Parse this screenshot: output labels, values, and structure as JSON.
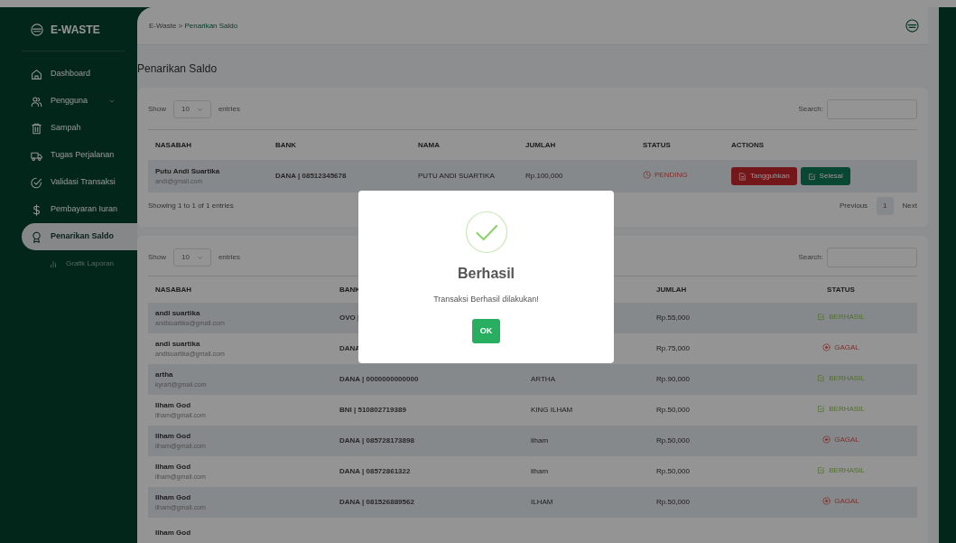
{
  "sidebar": {
    "logo": "E-WASTE",
    "items": [
      {
        "label": "Dashboard",
        "kind": "item",
        "selected": false
      },
      {
        "label": "Pengguna",
        "kind": "dropdown",
        "selected": false,
        "expanded": false
      },
      {
        "label": "Sampah",
        "kind": "item",
        "selected": false
      },
      {
        "label": "Tugas Perjalanan",
        "kind": "item",
        "selected": false
      },
      {
        "label": "Validasi Transaksi",
        "kind": "item",
        "selected": false
      },
      {
        "label": "Pembayaran Iuran",
        "kind": "item",
        "selected": false
      },
      {
        "label": "Penarikan Saldo",
        "kind": "item",
        "selected": true
      },
      {
        "label": "Grafik Laporan",
        "kind": "subitem",
        "selected": false
      }
    ]
  },
  "breadcrumb": {
    "items": [
      "E-Waste",
      "Penarikan Saldo"
    ],
    "separator": ">"
  },
  "page_title": "Penarikan Saldo",
  "pending_table": {
    "show_label": "Show",
    "length": "10",
    "entries_label": "entries",
    "search_label": "Search:",
    "columns": [
      "NASABAH",
      "BANK",
      "NAMA",
      "JUMLAH",
      "STATUS",
      "ACTIONS"
    ],
    "rows": [
      {
        "name": "Putu Andi Suartika",
        "email": "andi@gmail.com",
        "bank": "DANA | 08512345678",
        "nama": "PUTU ANDI SUARTIKA",
        "jumlah": "Rp.100,000",
        "status": {
          "kind": "pending",
          "label": "PENDING"
        },
        "actions": [
          "Tangguhkan",
          "Selesai"
        ]
      }
    ],
    "info": "Showing 1 to 1 of 1 entries",
    "pagination": {
      "previous": "Previous",
      "pages": [
        {
          "label": "1",
          "selected": true
        }
      ],
      "next": "Next"
    }
  },
  "history_table": {
    "show_label": "Show",
    "length": "10",
    "entries_label": "entries",
    "search_label": "Search:",
    "columns": [
      "NASABAH",
      "BANK",
      "JUMLAH",
      "STATUS"
    ],
    "rows": [
      {
        "name": "andi suartika",
        "email": "andisuartika@gmail.com",
        "bank": "OVO |",
        "jumlah": "Rp.55,000",
        "status": {
          "kind": "berhasil",
          "label": "BERHASIL"
        }
      },
      {
        "name": "andi suartika",
        "email": "andisuartika@gmail.com",
        "bank": "DANA",
        "jumlah": "Rp.75,000",
        "status": {
          "kind": "gagal",
          "label": "GAGAL"
        }
      },
      {
        "name": "artha",
        "email": "kyrart@gmail.com",
        "bank": "DANA | 0000000000000",
        "nama": "ARTHA",
        "jumlah": "Rp.90,000",
        "status": {
          "kind": "berhasil",
          "label": "BERHASIL"
        }
      },
      {
        "name": "Ilham God",
        "email": "ilham@gmail.com",
        "bank": "BNI | 510802719389",
        "nama": "KING ILHAM",
        "jumlah": "Rp.50,000",
        "status": {
          "kind": "berhasil",
          "label": "BERHASIL"
        }
      },
      {
        "name": "Ilham God",
        "email": "ilham@gmail.com",
        "bank": "DANA | 085728173898",
        "nama": "ilham",
        "jumlah": "Rp.50,000",
        "status": {
          "kind": "gagal",
          "label": "GAGAL"
        }
      },
      {
        "name": "Ilham God",
        "email": "ilham@gmail.com",
        "bank": "DANA | 08572861322",
        "nama": "ilham",
        "jumlah": "Rp.50,000",
        "status": {
          "kind": "berhasil",
          "label": "BERHASIL"
        }
      },
      {
        "name": "Ilham God",
        "email": "ilham@gmail.com",
        "bank": "DANA | 081526889562",
        "nama": "ILHAM",
        "jumlah": "Rp.50,000",
        "status": {
          "kind": "gagal",
          "label": "GAGAL"
        }
      },
      {
        "name": "Ilham God"
      }
    ]
  },
  "dialog": {
    "title": "Berhasil",
    "message": "Transaksi Berhasil dilakukan!",
    "button": "OK"
  }
}
